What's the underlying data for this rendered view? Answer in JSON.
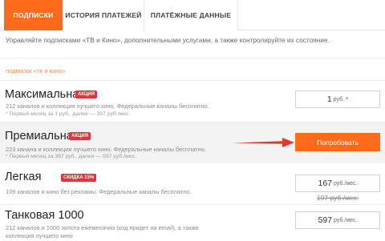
{
  "tabs": [
    {
      "label": "ПОДПИСКИ",
      "active": true
    },
    {
      "label": "ИСТОРИЯ ПЛАТЕЖЕЙ",
      "active": false
    },
    {
      "label": "ПЛАТЁЖНЫЕ ДАННЫЕ",
      "active": false
    }
  ],
  "intro_text": "Управляйте подписками «ТВ и Кино», дополнительными услугами, а также контролируйте их состояние.",
  "section_label": "подписки «тв и кино»",
  "plans": [
    {
      "name": "Максимальная",
      "badge": "АКЦИЯ",
      "description": "212 каналов и коллекция лучшего кино. Федеральные каналы бесплатно.",
      "note": "* Первый месяц за 1 руб., далее — 397 руб./мес.",
      "price": "1",
      "unit": "руб.",
      "star": "*"
    },
    {
      "name": "Премиальная",
      "badge": "АКЦИЯ",
      "description": "223 канала и коллекция лучшего кино. Федеральные каналы бесплатно.",
      "note": "* Первый месяц за 397 руб., далее — 597 руб./мес.",
      "button": "Попробовать"
    },
    {
      "name": "Легкая",
      "badge": "СКИДКА 15%",
      "description": "109 каналов и кино без рекламы. Федеральные каналы бесплатно.",
      "price": "167",
      "unit": "руб./мес.",
      "old_price": "197 руб./мес."
    },
    {
      "name": "Танковая 1000",
      "description": "212 каналов и 1000 золота ежемесячно (код придет на email), а также",
      "description_line2": "коллекция лучшего кино",
      "price": "597",
      "unit": "руб./мес."
    }
  ],
  "colors": {
    "accent": "#ff6a1a",
    "badge": "#e8313a",
    "arrow": "#e03a2e"
  }
}
